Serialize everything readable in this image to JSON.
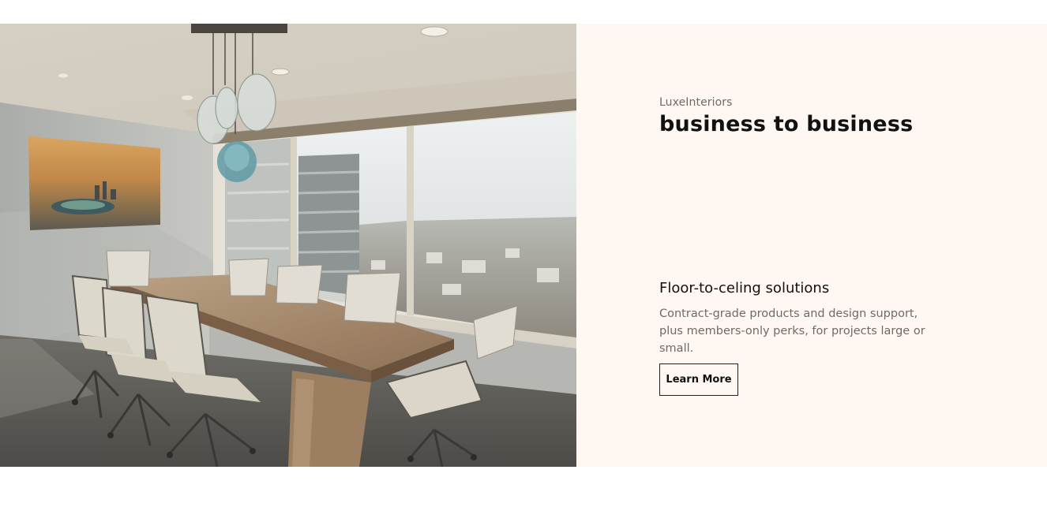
{
  "hero": {
    "image_alt": "Conference room with wooden table, white chairs and city view",
    "brand": "LuxeInteriors",
    "headline": "business to business",
    "subheading": "Floor-to-celing solutions",
    "description": "Contract-grade products and design support, plus members-only perks, for projects large or small.",
    "cta_label": "Learn More"
  },
  "colors": {
    "panel_background": "#fff7f1",
    "text_primary": "#111111",
    "text_secondary": "#6f6a67"
  }
}
